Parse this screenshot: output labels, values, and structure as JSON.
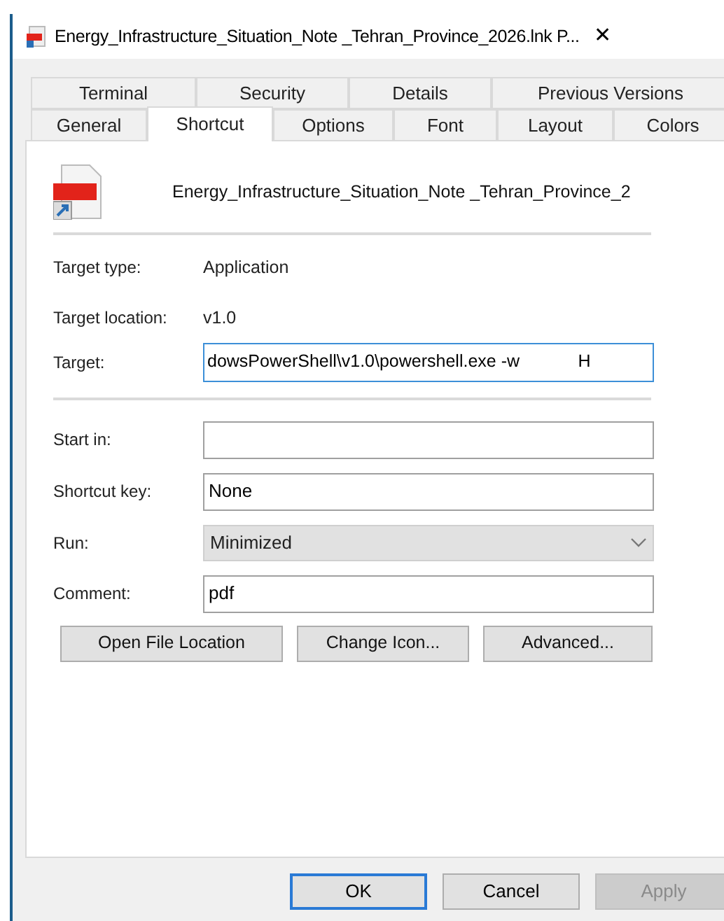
{
  "window": {
    "title": "Energy_Infrastructure_Situation_Note _Tehran_Province_2026.lnk P...",
    "close": "✕"
  },
  "tab_rows": [
    [
      {
        "label": "Terminal",
        "selected": false
      },
      {
        "label": "Security",
        "selected": false
      },
      {
        "label": "Details",
        "selected": false
      },
      {
        "label": "Previous Versions",
        "selected": false
      }
    ],
    [
      {
        "label": "General",
        "selected": false
      },
      {
        "label": "Shortcut",
        "selected": true
      },
      {
        "label": "Options",
        "selected": false
      },
      {
        "label": "Font",
        "selected": false
      },
      {
        "label": "Layout",
        "selected": false
      },
      {
        "label": "Colors",
        "selected": false
      }
    ]
  ],
  "file_name": "Energy_Infrastructure_Situation_Note _Tehran_Province_2",
  "info": [
    {
      "label": "Target type:",
      "value": "Application"
    },
    {
      "label": "Target location:",
      "value": "v1.0"
    }
  ],
  "target": {
    "label": "Target:",
    "value": "dowsPowerShell\\v1.0\\powershell.exe -w            H",
    "focused": true
  },
  "fields": [
    {
      "kind": "text",
      "label": "Start in:"
    },
    {
      "kind": "text",
      "label": "Shortcut key:",
      "value": "None"
    },
    {
      "kind": "select",
      "label": "Run:",
      "value": "Minimized"
    },
    {
      "kind": "text",
      "label": "Comment:",
      "value": "pdf"
    }
  ],
  "actions": [
    "Open File Location",
    "Change Icon...",
    "Advanced..."
  ],
  "buttons": [
    {
      "label": "OK",
      "default": true,
      "disabled": false
    },
    {
      "label": "Cancel",
      "default": false,
      "disabled": false
    },
    {
      "label": "Apply",
      "default": false,
      "disabled": true
    }
  ]
}
